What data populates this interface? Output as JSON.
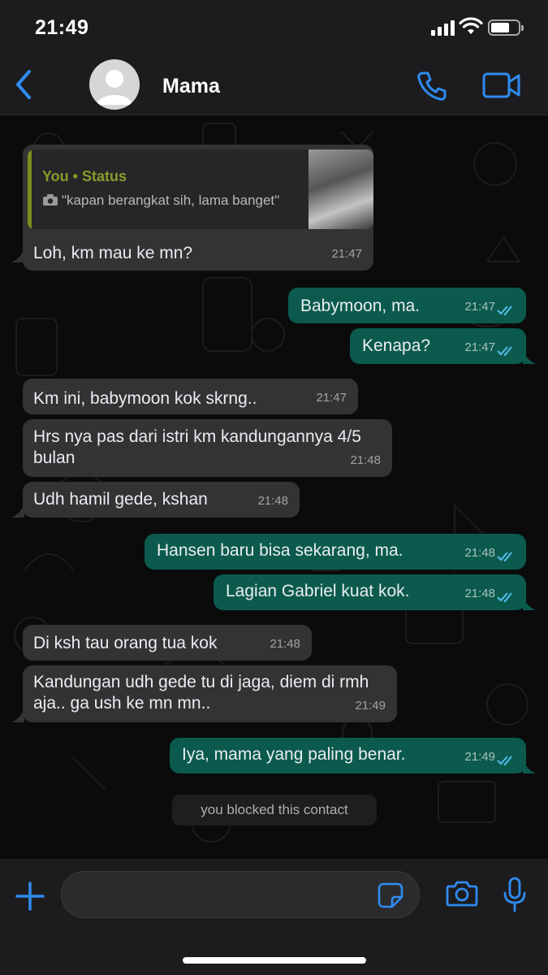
{
  "status_bar": {
    "time": "21:49"
  },
  "header": {
    "contact_name": "Mama"
  },
  "quoted_status": {
    "author": "You • Status",
    "quote": "\"kapan berangkat sih, lama banget\""
  },
  "messages": [
    {
      "direction": "in",
      "text": "Loh, km mau ke mn?",
      "time": "21:47"
    },
    {
      "direction": "out",
      "text": "Babymoon, ma.",
      "time": "21:47"
    },
    {
      "direction": "out",
      "text": "Kenapa?",
      "time": "21:47"
    },
    {
      "direction": "in",
      "text": "Km ini, babymoon kok skrng..",
      "time": "21:47"
    },
    {
      "direction": "in",
      "text": "Hrs nya pas dari istri km kandungannya 4/5 bulan",
      "time": "21:48"
    },
    {
      "direction": "in",
      "text": "Udh hamil gede, kshan",
      "time": "21:48"
    },
    {
      "direction": "out",
      "text": "Hansen baru bisa sekarang, ma.",
      "time": "21:48"
    },
    {
      "direction": "out",
      "text": "Lagian Gabriel kuat kok.",
      "time": "21:48"
    },
    {
      "direction": "in",
      "text": "Di ksh tau orang tua kok",
      "time": "21:48"
    },
    {
      "direction": "in",
      "text": "Kandungan udh gede tu di jaga, diem di rmh aja.. ga ush ke mn mn..",
      "time": "21:49"
    },
    {
      "direction": "out",
      "text": "Iya, mama yang paling benar.",
      "time": "21:49"
    }
  ],
  "system_notice": "you blocked this contact",
  "composer": {
    "placeholder": ""
  },
  "colors": {
    "accent": "#2e8bf0",
    "outgoing_bubble": "#0b5a4d",
    "incoming_bubble": "#333335",
    "read_ticks": "#53bdeb"
  },
  "icons": [
    "back-chevron-icon",
    "avatar-placeholder-icon",
    "phone-icon",
    "video-camera-icon",
    "plus-icon",
    "sticker-icon",
    "camera-icon",
    "microphone-icon",
    "camera-small-icon",
    "double-check-icon"
  ]
}
